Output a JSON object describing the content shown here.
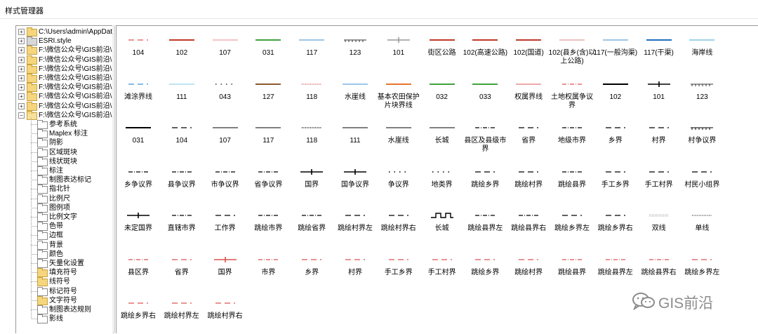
{
  "window": {
    "title": "样式管理器"
  },
  "tree": {
    "roots": [
      {
        "label": "C:\\Users\\admin\\AppData\\",
        "type": "folder"
      },
      {
        "label": "ESRI.style",
        "type": "style"
      },
      {
        "label": "F:\\微信公众号\\GIS前沿\\",
        "type": "folder"
      },
      {
        "label": "F:\\微信公众号\\GIS前沿\\",
        "type": "folder"
      },
      {
        "label": "F:\\微信公众号\\GIS前沿\\",
        "type": "folder"
      },
      {
        "label": "F:\\微信公众号\\GIS前沿\\",
        "type": "folder"
      },
      {
        "label": "F:\\微信公众号\\GIS前沿\\",
        "type": "folder"
      },
      {
        "label": "F:\\微信公众号\\GIS前沿\\",
        "type": "folder"
      },
      {
        "label": "F:\\微信公众号\\GIS前沿\\",
        "type": "folder"
      },
      {
        "label": "F:\\微信公众号\\GIS前沿\\",
        "type": "folder-open"
      }
    ],
    "children": [
      {
        "label": "参考系统",
        "type": "empty"
      },
      {
        "label": "Maplex 标注",
        "type": "empty"
      },
      {
        "label": "阴影",
        "type": "empty"
      },
      {
        "label": "区域斑块",
        "type": "empty"
      },
      {
        "label": "线状斑块",
        "type": "empty"
      },
      {
        "label": "标注",
        "type": "empty"
      },
      {
        "label": "制图表达标记",
        "type": "empty"
      },
      {
        "label": "指北针",
        "type": "empty"
      },
      {
        "label": "比例尺",
        "type": "empty"
      },
      {
        "label": "图例项",
        "type": "empty"
      },
      {
        "label": "比例文字",
        "type": "empty"
      },
      {
        "label": "色带",
        "type": "empty"
      },
      {
        "label": "边框",
        "type": "empty"
      },
      {
        "label": "背景",
        "type": "empty"
      },
      {
        "label": "颜色",
        "type": "empty"
      },
      {
        "label": "矢量化设置",
        "type": "empty"
      },
      {
        "label": "填充符号",
        "type": "folder"
      },
      {
        "label": "线符号",
        "type": "folder"
      },
      {
        "label": "标记符号",
        "type": "empty"
      },
      {
        "label": "文字符号",
        "type": "folder"
      },
      {
        "label": "制图表达规则",
        "type": "empty"
      },
      {
        "label": "影线",
        "type": "empty"
      }
    ]
  },
  "symbols": [
    [
      {
        "label": "104",
        "color": "#d9534f",
        "style": "dash"
      },
      {
        "label": "102",
        "color": "#c0392b",
        "style": "solid"
      },
      {
        "label": "107",
        "color": "#e88a8a",
        "style": "solid-thin"
      },
      {
        "label": "031",
        "color": "#3fa33f",
        "style": "solid"
      },
      {
        "label": "117",
        "color": "#3a8fd6",
        "style": "solid-thin"
      },
      {
        "label": "123",
        "color": "#333333",
        "style": "ticks"
      },
      {
        "label": "101",
        "color": "#999999",
        "style": "cross"
      },
      {
        "label": "街区公路",
        "color": "#c0392b",
        "style": "solid"
      },
      {
        "label": "102(高速公路)",
        "color": "#c0392b",
        "style": "solid"
      },
      {
        "label": "102(国道)",
        "color": "#c0392b",
        "style": "solid"
      },
      {
        "label": "102(县乡(含)以上公路)",
        "color": "#d98080",
        "style": "solid-thin"
      },
      {
        "label": "117(一般沟渠)",
        "color": "#3a8fd6",
        "style": "solid-thin"
      },
      {
        "label": "117(干渠)",
        "color": "#1f6fbf",
        "style": "solid"
      },
      {
        "label": "海岸线",
        "color": "#3aa0d6",
        "style": "solid-thin"
      }
    ],
    [
      {
        "label": "滩涂界线",
        "color": "#3a8fd6",
        "style": "dash"
      },
      {
        "label": "111",
        "color": "#7fc9e6",
        "style": "solid-thin"
      },
      {
        "label": "043",
        "color": "#333333",
        "style": "dots"
      },
      {
        "label": "127",
        "color": "#8a5a2b",
        "style": "solid"
      },
      {
        "label": "118",
        "color": "#d9534f",
        "style": "dotted"
      },
      {
        "label": "水崖线",
        "color": "#3a8fd6",
        "style": "solid-thin"
      },
      {
        "label": "基本农田保护片块界线",
        "color": "#e8742a",
        "style": "solid"
      },
      {
        "label": "032",
        "color": "#3fa33f",
        "style": "solid"
      },
      {
        "label": "033",
        "color": "#3fa33f",
        "style": "solid"
      },
      {
        "label": "权属界线",
        "color": "#d9534f",
        "style": "solid-thin"
      },
      {
        "label": "土地权属争议界",
        "color": "#d9534f",
        "style": "dashdot"
      },
      {
        "label": "102",
        "color": "#000000",
        "style": "solid"
      },
      {
        "label": "101",
        "color": "#000000",
        "style": "cross"
      },
      {
        "label": "123",
        "color": "#333333",
        "style": "ticks"
      }
    ],
    [
      {
        "label": "031",
        "color": "#000000",
        "style": "solid"
      },
      {
        "label": "104",
        "color": "#000000",
        "style": "dash"
      },
      {
        "label": "107",
        "color": "#000000",
        "style": "solid-thin"
      },
      {
        "label": "117",
        "color": "#000000",
        "style": "solid-thin"
      },
      {
        "label": "118",
        "color": "#000000",
        "style": "dotted"
      },
      {
        "label": "111",
        "color": "#000000",
        "style": "solid-thin"
      },
      {
        "label": "水崖线",
        "color": "#000000",
        "style": "solid-thin"
      },
      {
        "label": "长城",
        "color": "#000000",
        "style": "solid-thin"
      },
      {
        "label": "县区及县级市界",
        "color": "#000000",
        "style": "dashdot"
      },
      {
        "label": "省界",
        "color": "#000000",
        "style": "dash"
      },
      {
        "label": "地级市界",
        "color": "#000000",
        "style": "dashdot"
      },
      {
        "label": "乡界",
        "color": "#000000",
        "style": "dash"
      },
      {
        "label": "村界",
        "color": "#000000",
        "style": "dash"
      },
      {
        "label": "村争议界",
        "color": "#000000",
        "style": "ticks"
      }
    ],
    [
      {
        "label": "乡争议界",
        "color": "#000000",
        "style": "dashdot"
      },
      {
        "label": "县争议界",
        "color": "#000000",
        "style": "dashdot"
      },
      {
        "label": "市争议界",
        "color": "#000000",
        "style": "dashdot"
      },
      {
        "label": "省争议界",
        "color": "#000000",
        "style": "dashdot"
      },
      {
        "label": "国界",
        "color": "#000000",
        "style": "cross"
      },
      {
        "label": "国争议界",
        "color": "#000000",
        "style": "cross"
      },
      {
        "label": "争议界",
        "color": "#000000",
        "style": "dots"
      },
      {
        "label": "地类界",
        "color": "#000000",
        "style": "dots"
      },
      {
        "label": "跳绘乡界",
        "color": "#000000",
        "style": "dash"
      },
      {
        "label": "跳绘村界",
        "color": "#000000",
        "style": "dash"
      },
      {
        "label": "跳绘县界",
        "color": "#000000",
        "style": "dashdot"
      },
      {
        "label": "手工乡界",
        "color": "#000000",
        "style": "dash"
      },
      {
        "label": "手工村界",
        "color": "#000000",
        "style": "dash"
      },
      {
        "label": "村民小组界",
        "color": "#000000",
        "style": "dash"
      }
    ],
    [
      {
        "label": "未定国界",
        "color": "#000000",
        "style": "cross"
      },
      {
        "label": "直辖市界",
        "color": "#000000",
        "style": "dashdot"
      },
      {
        "label": "工作界",
        "color": "#000000",
        "style": "dash"
      },
      {
        "label": "跳绘市界",
        "color": "#000000",
        "style": "dashdot"
      },
      {
        "label": "跳绘省界",
        "color": "#000000",
        "style": "dashdot"
      },
      {
        "label": "跳绘村界左",
        "color": "#000000",
        "style": "dash"
      },
      {
        "label": "跳绘村界右",
        "color": "#000000",
        "style": "dash"
      },
      {
        "label": "长城",
        "color": "#000000",
        "style": "wall"
      },
      {
        "label": "跳绘县界左",
        "color": "#000000",
        "style": "dashdot"
      },
      {
        "label": "跳绘县界右",
        "color": "#000000",
        "style": "dashdot"
      },
      {
        "label": "跳绘乡界左",
        "color": "#000000",
        "style": "dash"
      },
      {
        "label": "跳绘乡界右",
        "color": "#000000",
        "style": "dash"
      },
      {
        "label": "双线",
        "color": "#888888",
        "style": "double"
      },
      {
        "label": "单线",
        "color": "#555555",
        "style": "dotted"
      }
    ],
    [
      {
        "label": "县区界",
        "color": "#d9534f",
        "style": "dashdot"
      },
      {
        "label": "省界",
        "color": "#d9534f",
        "style": "dash"
      },
      {
        "label": "国界",
        "color": "#d9534f",
        "style": "cross"
      },
      {
        "label": "市界",
        "color": "#d9534f",
        "style": "dashdot"
      },
      {
        "label": "乡界",
        "color": "#d9534f",
        "style": "dash"
      },
      {
        "label": "村界",
        "color": "#d9534f",
        "style": "dash"
      },
      {
        "label": "手工乡界",
        "color": "#d9534f",
        "style": "dash"
      },
      {
        "label": "手工村界",
        "color": "#d9534f",
        "style": "dash"
      },
      {
        "label": "跳绘乡界",
        "color": "#d9534f",
        "style": "dash"
      },
      {
        "label": "跳绘村界",
        "color": "#d9534f",
        "style": "dash"
      },
      {
        "label": "跳绘县界",
        "color": "#d9534f",
        "style": "dashdot"
      },
      {
        "label": "跳绘县界左",
        "color": "#d9534f",
        "style": "dashdot"
      },
      {
        "label": "跳绘县界右",
        "color": "#d9534f",
        "style": "dashdot"
      },
      {
        "label": "跳绘乡界左",
        "color": "#d9534f",
        "style": "dash"
      }
    ],
    [
      {
        "label": "跳绘乡界右",
        "color": "#d9534f",
        "style": "dash"
      },
      {
        "label": "跳绘村界左",
        "color": "#d9534f",
        "style": "dash"
      },
      {
        "label": "跳绘村界右",
        "color": "#d9534f",
        "style": "dash"
      }
    ]
  ],
  "watermark": {
    "text": "GIS前沿",
    "icon": "wechat-icon"
  }
}
